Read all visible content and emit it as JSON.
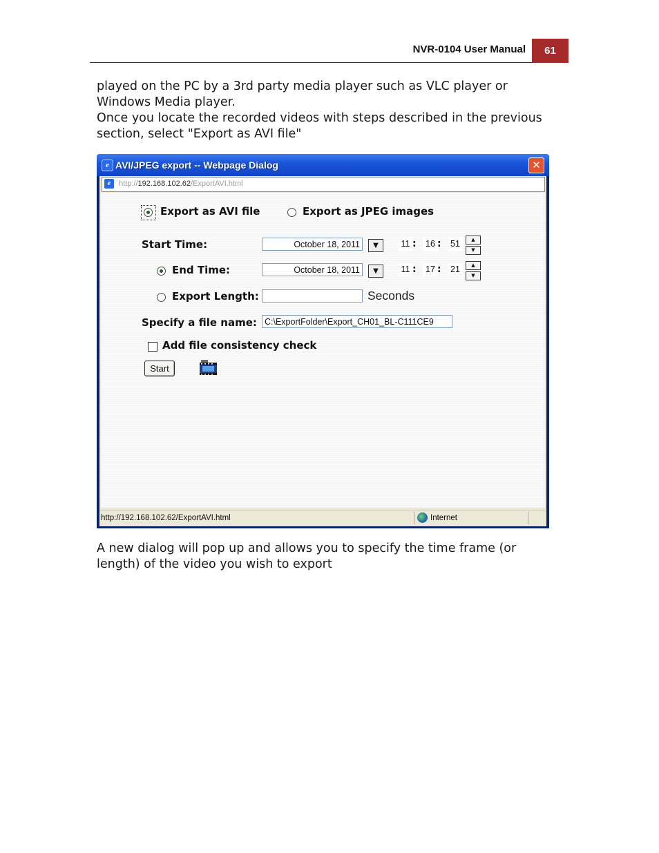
{
  "header": {
    "manual_title": "NVR-0104 User Manual",
    "page_number": "61"
  },
  "body": {
    "para1": "played on the PC by a 3rd party media player such as VLC player or Windows Media player.",
    "para2": "Once you locate the recorded videos with steps described in the previous section, select \"Export as AVI file\"",
    "para3": "A new dialog will pop up and allows you to specify the time frame (or length) of the video you wish to export"
  },
  "dialog": {
    "title": "AVI/JPEG export -- Webpage Dialog",
    "address": {
      "scheme": "http://",
      "host": "192.168.102.62",
      "path": "/ExportAVI.html"
    },
    "export_avi_label": "Export as AVI file",
    "export_jpeg_label": "Export as JPEG images",
    "export_mode": "avi",
    "start_time_label": "Start Time:",
    "start_date": "October 18, 2011",
    "start_hour": "11",
    "start_minute": "16",
    "start_second": "51",
    "end_time_label": "End Time:",
    "end_date": "October 18, 2011",
    "end_hour": "11",
    "end_minute": "17",
    "end_second": "21",
    "range_mode": "end_time",
    "export_length_label": "Export Length:",
    "export_length_value": "",
    "seconds_label": "Seconds",
    "file_name_label": "Specify a file name:",
    "file_name_value": "C:\\ExportFolder\\Export_CH01_BL-C111CE9",
    "consistency_check_label": "Add file consistency check",
    "consistency_check_checked": false,
    "start_button": "Start",
    "colon": ":",
    "status_url": "http://192.168.102.62/ExportAVI.html",
    "status_zone": "Internet"
  },
  "icons": {
    "ie": "ie-icon",
    "close": "close-icon",
    "film": "film-icon",
    "globe": "globe-icon",
    "dropdown": "chevron-down-icon",
    "spin_up": "arrow-up-icon",
    "spin_down": "arrow-down-icon"
  },
  "colors": {
    "page_badge": "#a52a2a",
    "titlebar": "#1a55d8"
  }
}
